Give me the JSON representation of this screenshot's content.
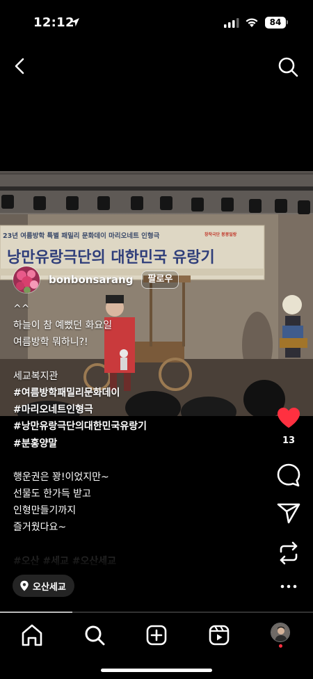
{
  "status_bar": {
    "time": "12:12",
    "battery": "84"
  },
  "nav": {
    "back_icon": "chevron-left-icon",
    "search_icon": "search-icon"
  },
  "post": {
    "banner": {
      "top_line": "23년 여름방학 특별 패밀리 문화데이 마리오네트 인형극",
      "main_title": "낭만유랑극단의 대한민국 유랑기",
      "badge": "창작극단 봉봉일랑"
    },
    "username": "bonbonsarang",
    "follow_label": "팔로우",
    "caption_lines": [
      {
        "text": "^^",
        "style": "normal"
      },
      {
        "text": "하늘이 참 예뻤던 화요일",
        "style": "normal"
      },
      {
        "text": "여름방학 뭐하니?!",
        "style": "normal"
      },
      {
        "text": "",
        "style": "gap"
      },
      {
        "text": "세교복지관",
        "style": "normal"
      },
      {
        "text": "#여름방학패밀리문화데이",
        "style": "tag"
      },
      {
        "text": "#마리오네트인형극",
        "style": "tag"
      },
      {
        "text": "#낭만유랑극단의대한민국유랑기",
        "style": "tag"
      },
      {
        "text": "#분홍양말",
        "style": "tag"
      },
      {
        "text": "",
        "style": "gap"
      },
      {
        "text": "행운권은 꽝!이었지만~",
        "style": "normal"
      },
      {
        "text": "선물도 한가득 받고",
        "style": "normal"
      },
      {
        "text": "인형만들기까지",
        "style": "normal"
      },
      {
        "text": "즐거웠다요~",
        "style": "normal"
      },
      {
        "text": "",
        "style": "gap"
      },
      {
        "text": "#오산 #세교 #오산세교",
        "style": "faded"
      }
    ],
    "location": "오산세교",
    "like_count": "13",
    "progress": 0.23
  },
  "colors": {
    "like": "#ff3040",
    "notification": "#ff3040",
    "background": "#000000"
  },
  "tabs": [
    {
      "name": "home-icon"
    },
    {
      "name": "search-icon"
    },
    {
      "name": "create-icon"
    },
    {
      "name": "reels-icon"
    },
    {
      "name": "profile-avatar"
    }
  ]
}
